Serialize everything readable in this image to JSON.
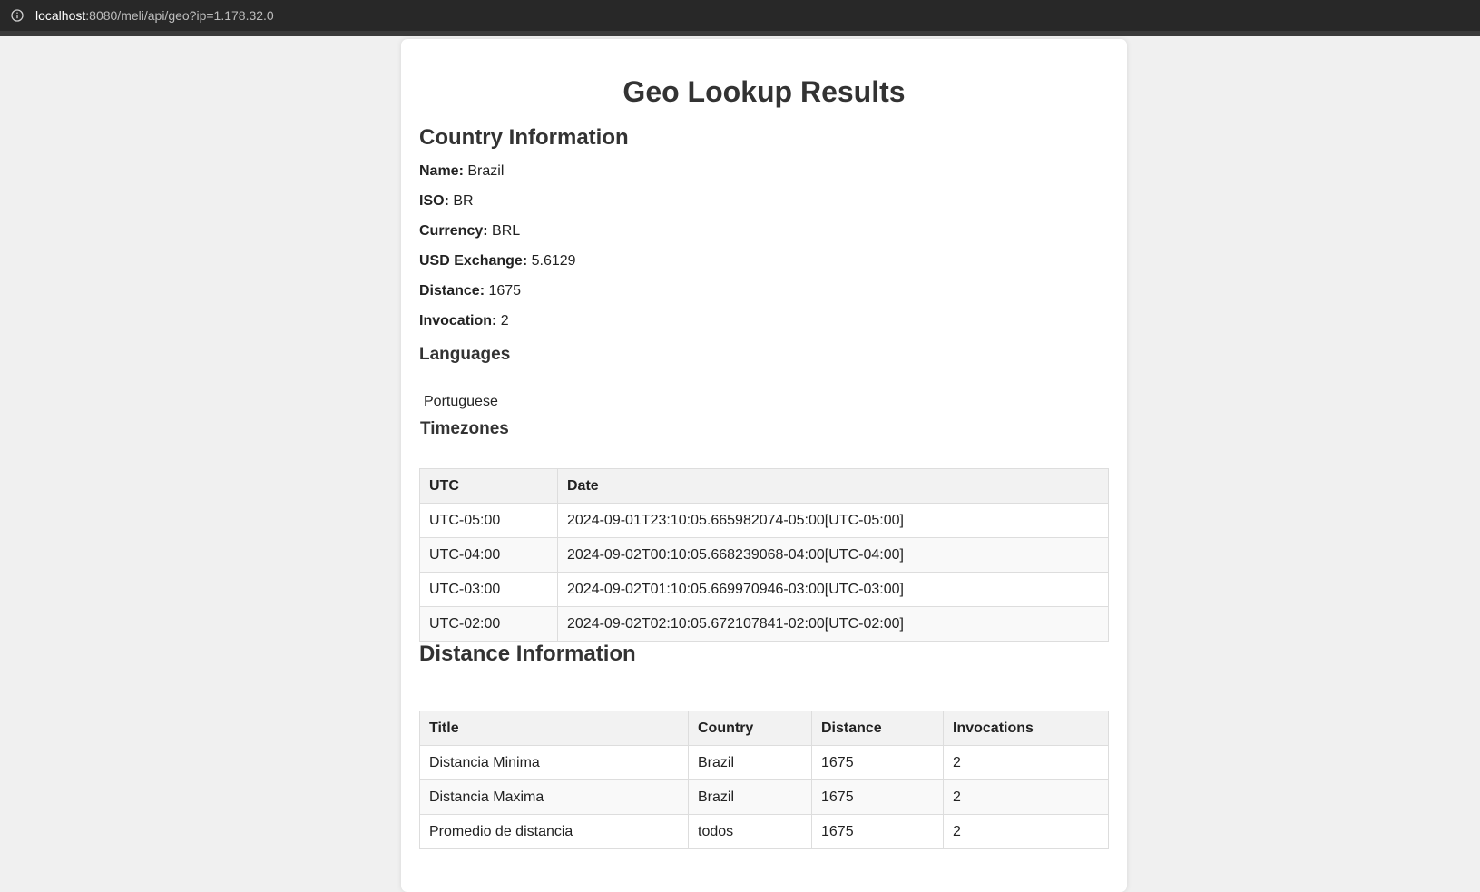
{
  "browser": {
    "url_host": "localhost",
    "url_rest": ":8080/meli/api/geo?ip=1.178.32.0"
  },
  "page": {
    "title": "Geo Lookup Results"
  },
  "country": {
    "heading": "Country Information",
    "fields": [
      {
        "label": "Name:",
        "value": "Brazil"
      },
      {
        "label": "ISO:",
        "value": "BR"
      },
      {
        "label": "Currency:",
        "value": "BRL"
      },
      {
        "label": "USD Exchange:",
        "value": "5.6129"
      },
      {
        "label": "Distance:",
        "value": "1675"
      },
      {
        "label": "Invocation:",
        "value": "2"
      }
    ]
  },
  "languages": {
    "heading": "Languages",
    "items": [
      "Portuguese"
    ]
  },
  "timezones": {
    "heading": "Timezones",
    "columns": [
      "UTC",
      "Date"
    ],
    "rows": [
      [
        "UTC-05:00",
        "2024-09-01T23:10:05.665982074-05:00[UTC-05:00]"
      ],
      [
        "UTC-04:00",
        "2024-09-02T00:10:05.668239068-04:00[UTC-04:00]"
      ],
      [
        "UTC-03:00",
        "2024-09-02T01:10:05.669970946-03:00[UTC-03:00]"
      ],
      [
        "UTC-02:00",
        "2024-09-02T02:10:05.672107841-02:00[UTC-02:00]"
      ]
    ]
  },
  "distance": {
    "heading": "Distance Information",
    "columns": [
      "Title",
      "Country",
      "Distance",
      "Invocations"
    ],
    "rows": [
      [
        "Distancia Minima",
        "Brazil",
        "1675",
        "2"
      ],
      [
        "Distancia Maxima",
        "Brazil",
        "1675",
        "2"
      ],
      [
        "Promedio de distancia",
        "todos",
        "1675",
        "2"
      ]
    ]
  }
}
